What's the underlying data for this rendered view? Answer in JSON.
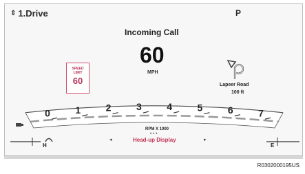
{
  "top_left": {
    "mode_label": "1.Drive",
    "updown_glyph": "⇕"
  },
  "top_right": {
    "gear": "P"
  },
  "notification": {
    "text": "Incoming Call"
  },
  "speedometer": {
    "value": "60",
    "unit": "MPH"
  },
  "speed_limit_sign": {
    "line1": "SPEED",
    "line2": "LIMIT",
    "value": "60"
  },
  "navigation": {
    "street": "Lapeer Road",
    "distance": "100 ft",
    "icon": "u-turn-arrow-icon"
  },
  "tachometer": {
    "labels": [
      "0",
      "1",
      "2",
      "3",
      "4",
      "5",
      "6",
      "7"
    ],
    "rpm_label": "RPM X 1000"
  },
  "hud": {
    "label": "Head-up Display",
    "prev": "◂",
    "next": "▸",
    "indicator_dots": "•••"
  },
  "gauges": {
    "temp_high": "H",
    "fuel_empty": "E",
    "temp_icon": "thermometer-icon",
    "fuel_icon": "fuel-pump-icon"
  },
  "figure_code": "R0302000195US",
  "colors": {
    "accent": "#c43455",
    "background": "#f7f7f7",
    "text": "#222222"
  }
}
